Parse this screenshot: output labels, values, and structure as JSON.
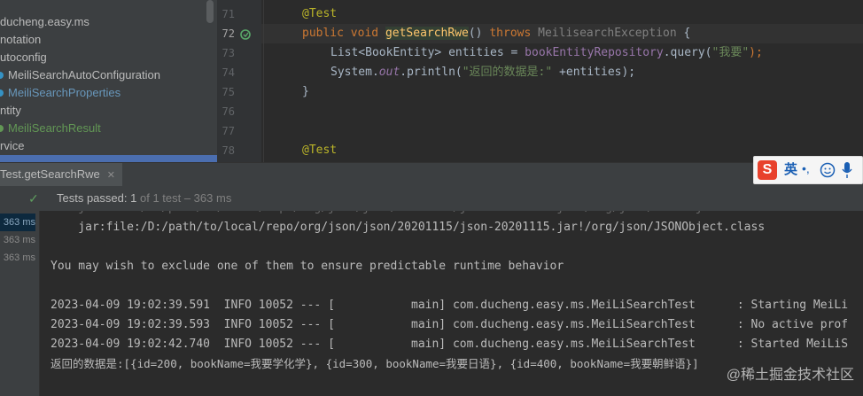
{
  "colors": {
    "keyword": "#cc7832",
    "annotation": "#bbb529",
    "string": "#6a8759",
    "function": "#ffc66d",
    "selection_blue": "#4b6eaf",
    "passed_green": "#5f9f5f"
  },
  "project_tree": {
    "items": [
      {
        "label": "ducheng.easy.ms",
        "icon": "folder-icon"
      },
      {
        "label": "notation",
        "icon": "folder-icon"
      },
      {
        "label": "utoconfig",
        "icon": "folder-icon"
      },
      {
        "label": "MeiliSearchAutoConfiguration",
        "icon": "class-icon"
      },
      {
        "label": "MeiliSearchProperties",
        "icon": "class-icon"
      },
      {
        "label": "ntity",
        "icon": "folder-icon"
      },
      {
        "label": "MeiliSearchResult",
        "icon": "class-icon"
      },
      {
        "label": "rvice",
        "icon": "folder-icon"
      }
    ]
  },
  "editor": {
    "line_numbers": [
      "71",
      "72",
      "73",
      "74",
      "75",
      "76",
      "77",
      "78"
    ],
    "current_line": "72",
    "lines": {
      "l71_annotation": "@Test",
      "l72_public": "public",
      "l72_void": "void",
      "l72_method": "getSearchRwe",
      "l72_parens": "()",
      "l72_throws": "throws",
      "l72_exception": "MeilisearchException",
      "l72_brace": "{",
      "l73_type": "List<BookEntity>",
      "l73_var": "entities",
      "l73_eq": "=",
      "l73_repo": "bookEntityRepository",
      "l73_call": ".query(",
      "l73_arg": "\"我要\"",
      "l73_end": ");",
      "l74_system": "System.",
      "l74_out": "out",
      "l74_println": ".println(",
      "l74_str": "\"返回的数据是:\"",
      "l74_rest": " +entities);",
      "l75_brace": "}",
      "l78_annotation": "@Test"
    }
  },
  "run_tab": {
    "label": "Test.getSearchRwe",
    "close_icon": "close-icon"
  },
  "ime": {
    "logo": "S",
    "lang": "英"
  },
  "test_status": {
    "label": "Tests passed:",
    "count": "1",
    "detail": "of 1 test – 363 ms"
  },
  "test_times": [
    "363 ms",
    "363 ms",
    "363 ms"
  ],
  "console": {
    "lines": [
      "    jar:file:/D:/path/to/local/repo/org/json/json/20201115/json-20201115.jar!/org/json/JSONObject.class",
      "",
      "You may wish to exclude one of them to ensure predictable runtime behavior",
      "",
      "2023-04-09 19:02:39.591  INFO 10052 --- [           main] com.ducheng.easy.ms.MeiLiSearchTest      : Starting MeiLi",
      "2023-04-09 19:02:39.593  INFO 10052 --- [           main] com.ducheng.easy.ms.MeiLiSearchTest      : No active prof",
      "2023-04-09 19:02:42.740  INFO 10052 --- [           main] com.ducheng.easy.ms.MeiLiSearchTest      : Started MeiLiS",
      "返回的数据是:[{id=200, bookName=我要学化学}, {id=300, bookName=我要日语}, {id=400, bookName=我要朝鲜语}]"
    ]
  },
  "watermark": "@稀土掘金技术社区"
}
